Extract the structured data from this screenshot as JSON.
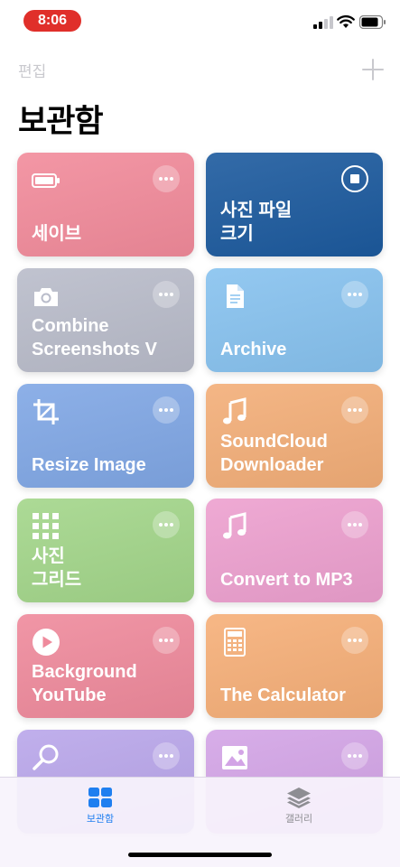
{
  "status_bar": {
    "time": "8:06",
    "time_pill_color": "#e02f2a"
  },
  "nav": {
    "edit_label": "편집",
    "add_icon": "plus-icon",
    "title": "보관함"
  },
  "cards": [
    {
      "label": "세이브",
      "icon": "battery-icon",
      "action": "more",
      "color": "#f28b9b"
    },
    {
      "label": "사진 파일\n크기",
      "icon": "",
      "action": "stop",
      "color": "#1c5a9e"
    },
    {
      "label": "Combine\nScreenshots V",
      "icon": "camera-icon",
      "action": "more",
      "color": "#b9bcca"
    },
    {
      "label": "Archive",
      "icon": "document-icon",
      "action": "more",
      "color": "#87c2ef"
    },
    {
      "label": "Resize Image",
      "icon": "crop-icon",
      "action": "more",
      "color": "#80a7e5"
    },
    {
      "label": "SoundCloud\nDownloader",
      "icon": "music-note-icon",
      "action": "more",
      "color": "#f3ae78"
    },
    {
      "label": "사진\n그리드",
      "icon": "grid-icon",
      "action": "more",
      "color": "#a3d68a"
    },
    {
      "label": "Convert to MP3",
      "icon": "music-note-icon",
      "action": "more",
      "color": "#eda0cf"
    },
    {
      "label": "Background\nYouTube",
      "icon": "play-icon",
      "action": "more",
      "color": "#ef8a9c"
    },
    {
      "label": "The Calculator",
      "icon": "calculator-icon",
      "action": "more",
      "color": "#f6af78"
    },
    {
      "label": "",
      "icon": "search-icon",
      "action": "more",
      "color": "#b9a6ea"
    },
    {
      "label": "",
      "icon": "photo-icon",
      "action": "more",
      "color": "#d3a4e6"
    }
  ],
  "tabs": [
    {
      "label": "보관함",
      "icon": "library-grid-icon",
      "active": true,
      "color": "#1f7ff0"
    },
    {
      "label": "갤러리",
      "icon": "layers-icon",
      "active": false,
      "color": "#8e8e93"
    }
  ]
}
